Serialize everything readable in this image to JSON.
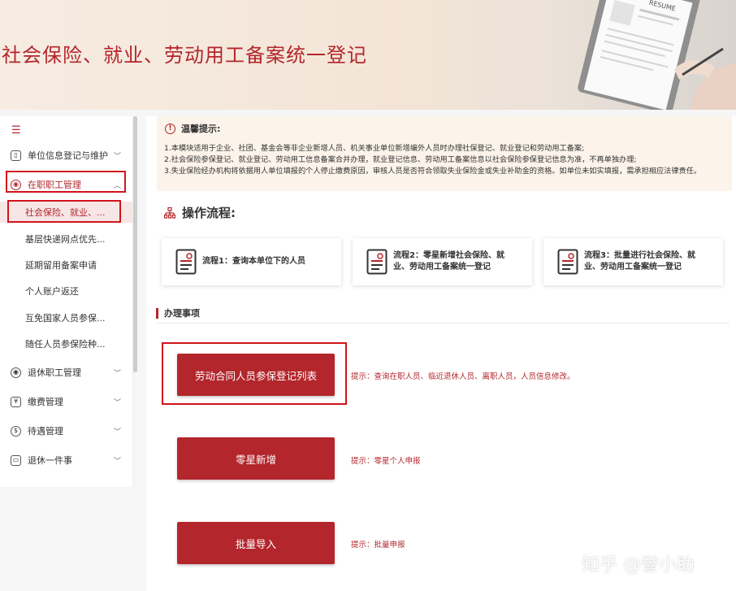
{
  "banner": {
    "title": "社会保险、就业、劳动用工备案统一登记",
    "paper_label": "RESUME"
  },
  "sidebar": {
    "toggle_icon": "menu-fold-icon",
    "menus": [
      {
        "label": "单位信息登记与维护",
        "icon": "building-icon"
      },
      {
        "label": "在职职工管理",
        "icon": "worker-icon"
      }
    ],
    "submenus": [
      {
        "label": "社会保险、就业、..."
      },
      {
        "label": "基层快递网点优先..."
      },
      {
        "label": "延期留用备案申请"
      },
      {
        "label": "个人账户返还"
      },
      {
        "label": "互免国家人员参保..."
      },
      {
        "label": "随任人员参保险种..."
      }
    ],
    "menus2": [
      {
        "label": "退休职工管理",
        "icon": "retiree-icon"
      },
      {
        "label": "缴费管理",
        "icon": "payment-icon"
      },
      {
        "label": "待遇管理",
        "icon": "benefit-icon"
      },
      {
        "label": "退休一件事",
        "icon": "retire-matter-icon"
      }
    ]
  },
  "notice": {
    "title": "温馨提示:",
    "lines": [
      "1.本模块适用于企业、社团、基金会等非企业新增人员、机关事业单位新增编外人员时办理社保登记、就业登记和劳动用工备案;",
      "2.社会保险参保登记、就业登记、劳动用工信息备案合并办理，就业登记信息、劳动用工备案信息以社会保险参保登记信息为准，不再单独办理;",
      "3.失业保险经办机构将依据用人单位填报的个人停止缴费原因，审核人员是否符合领取失业保险金或失业补助金的资格。如单位未如实填报，需承担相应法律责任。"
    ]
  },
  "process": {
    "title": "操作流程:",
    "steps": [
      {
        "line1": "流程1：查询本单位下的人员",
        "line2": ""
      },
      {
        "line1": "流程2：零星新增社会保险、就",
        "line2": "业、劳动用工备案统一登记"
      },
      {
        "line1": "流程3：批量进行社会保险、就",
        "line2": "业、劳动用工备案统一登记"
      }
    ]
  },
  "operations": {
    "title": "办理事项",
    "items": [
      {
        "button": "劳动合同人员参保登记列表",
        "hint": "提示：查询在职人员、临近退休人员、离职人员，人员信息修改。"
      },
      {
        "button": "零星新增",
        "hint": "提示：零星个人申报"
      },
      {
        "button": "批量导入",
        "hint": "提示：批量申报"
      }
    ]
  },
  "watermark": "知乎 @誉小助",
  "colors": {
    "brand_red": "#b3262c",
    "highlight_frame": "#d1141c",
    "notice_bg": "#fcf3ea"
  }
}
